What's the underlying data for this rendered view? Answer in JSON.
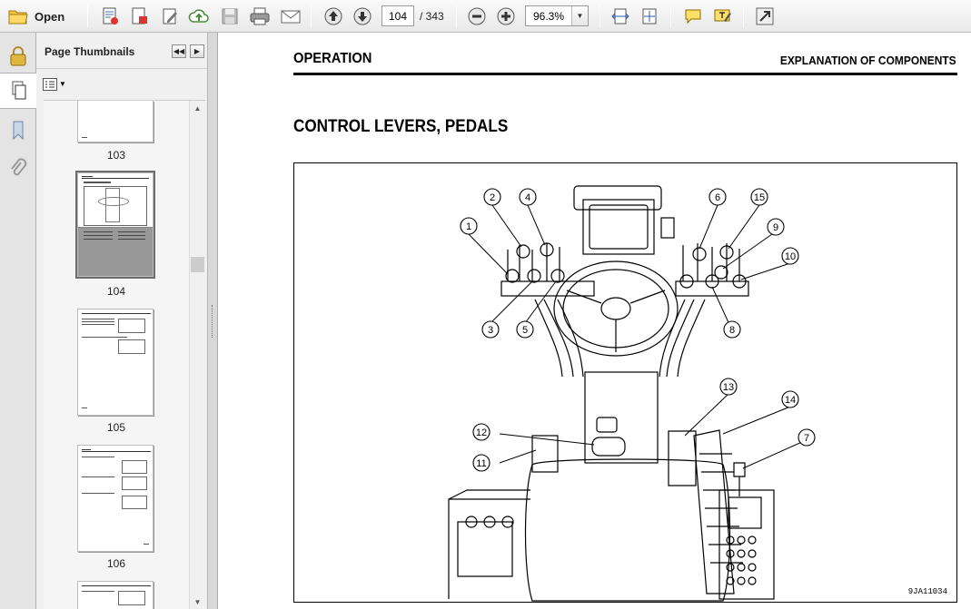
{
  "toolbar": {
    "open_label": "Open",
    "current_page": "104",
    "page_total": "/ 343",
    "zoom": "96.3%"
  },
  "thumbnails_panel": {
    "title": "Page Thumbnails",
    "pages": [
      {
        "label": "103"
      },
      {
        "label": "104"
      },
      {
        "label": "105"
      },
      {
        "label": "106"
      }
    ]
  },
  "document": {
    "header_left": "OPERATION",
    "header_right": "EXPLANATION OF COMPONENTS",
    "title": "CONTROL LEVERS, PEDALS",
    "figure": {
      "code": "9JA11034",
      "callouts": [
        "1",
        "2",
        "3",
        "4",
        "5",
        "6",
        "7",
        "8",
        "9",
        "10",
        "11",
        "12",
        "13",
        "14",
        "15"
      ]
    }
  },
  "colors": {
    "toolbar_bg": "#ececec",
    "panel_bg": "#f0f0f0",
    "selected_thumb": "#999999"
  }
}
